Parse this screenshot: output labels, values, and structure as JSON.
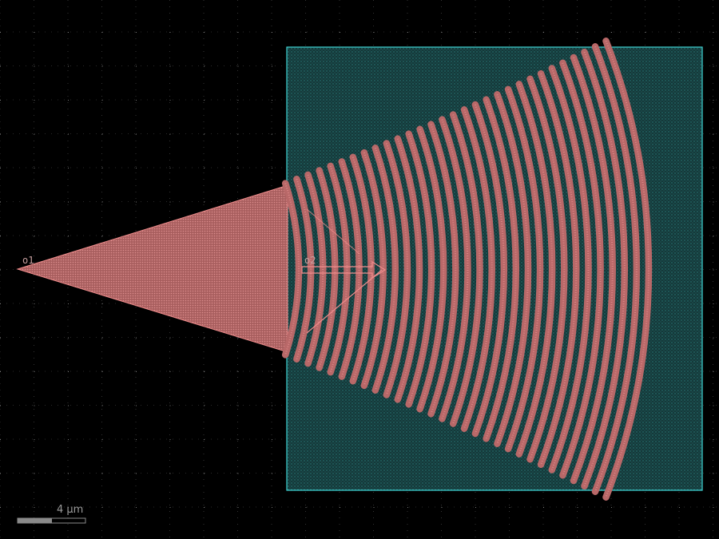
{
  "layout_view": {
    "background_color": "#000000",
    "grid_color": "#7a7a7a",
    "shape_color": "#f08c8c",
    "shape_fill": "#b86868",
    "box_color": "#40d8d8",
    "box_fill": "#1d4a4a",
    "grating_period_count": 30,
    "ports": [
      {
        "name": "o1"
      },
      {
        "name": "o2"
      }
    ],
    "scale_bar": {
      "label": "4  μm",
      "value_um": 4
    }
  }
}
